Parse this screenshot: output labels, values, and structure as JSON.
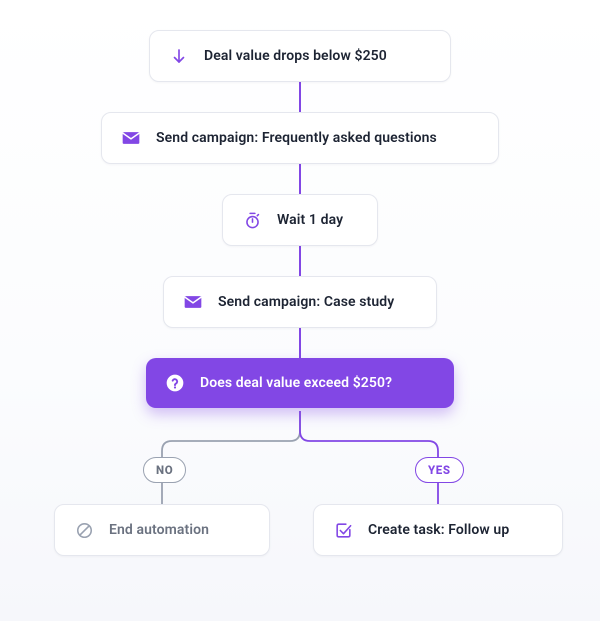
{
  "nodes": {
    "trigger": {
      "label": "Deal value drops below $250"
    },
    "send_faq": {
      "label": "Send campaign: Frequently asked questions"
    },
    "wait": {
      "label": "Wait 1 day"
    },
    "send_case": {
      "label": "Send campaign: Case study"
    },
    "condition": {
      "label": "Does deal value exceed $250?"
    },
    "end": {
      "label": "End automation"
    },
    "task": {
      "label": "Create task: Follow up"
    }
  },
  "branches": {
    "no": "NO",
    "yes": "YES"
  },
  "colors": {
    "accent": "#8247e5",
    "muted": "#6b7280"
  }
}
